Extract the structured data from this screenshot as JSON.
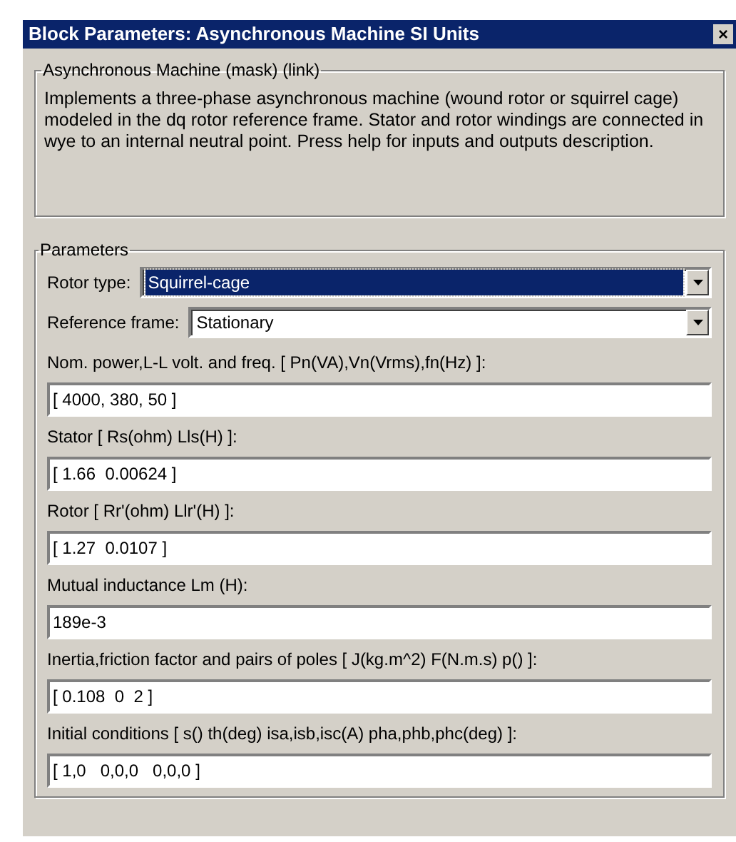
{
  "window": {
    "title": "Block Parameters: Asynchronous Machine SI Units",
    "close": "×"
  },
  "mask": {
    "title": "Asynchronous Machine (mask) (link)",
    "description": "Implements a three-phase asynchronous machine (wound rotor or squirrel cage) modeled in the dq rotor reference frame. Stator and rotor windings are connected in wye to an internal neutral point. Press help for inputs and outputs description."
  },
  "parameters": {
    "title": "Parameters",
    "fields": [
      {
        "kind": "dropdown",
        "label": "Rotor type:",
        "value": "Squirrel-cage",
        "selected": true
      },
      {
        "kind": "dropdown",
        "label": "Reference frame:",
        "value": "Stationary",
        "selected": false
      },
      {
        "kind": "text",
        "label": "Nom. power,L-L volt. and freq. [ Pn(VA),Vn(Vrms),fn(Hz) ]:",
        "value": "[ 4000, 380, 50 ]"
      },
      {
        "kind": "text",
        "label": "Stator [ Rs(ohm)  Lls(H) ]:",
        "value": "[ 1.66  0.00624 ]"
      },
      {
        "kind": "text",
        "label": "Rotor [ Rr'(ohm)  Llr'(H) ]:",
        "value": "[ 1.27  0.0107 ]"
      },
      {
        "kind": "text",
        "label": "Mutual inductance Lm (H):",
        "value": "189e-3"
      },
      {
        "kind": "text",
        "label": "Inertia,friction factor and pairs of poles [ J(kg.m^2)  F(N.m.s)  p() ]:",
        "value": "[ 0.108  0  2 ]"
      },
      {
        "kind": "text",
        "label": "Initial conditions [ s() th(deg)  isa,isb,isc(A)  pha,phb,phc(deg) ]:",
        "value": "[ 1,0   0,0,0   0,0,0 ]"
      }
    ]
  }
}
